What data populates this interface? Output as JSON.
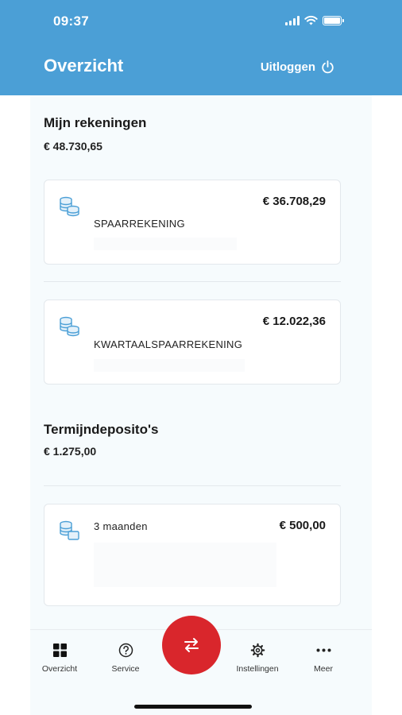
{
  "status_bar": {
    "time": "09:37",
    "icons": [
      "signal-icon",
      "wifi-icon",
      "battery-icon"
    ]
  },
  "header": {
    "title": "Overzicht",
    "logout_label": "Uitloggen",
    "logout_icon": "power-icon",
    "background": "#4b9fd6"
  },
  "accounts": {
    "title": "Mijn rekeningen",
    "total": "€ 48.730,65",
    "items": [
      {
        "label": "SPAARREKENING",
        "amount": "€ 36.708,29",
        "icon": "coins-stack-icon"
      },
      {
        "label": "KWARTAALSPAARREKENING",
        "amount": "€ 12.022,36",
        "icon": "coins-stack-icon"
      }
    ]
  },
  "deposits": {
    "title": "Termijndeposito's",
    "total": "€ 1.275,00",
    "items": [
      {
        "label": "3 maanden",
        "amount": "€ 500,00",
        "icon": "coins-stack-icon"
      }
    ]
  },
  "tabbar": {
    "items": [
      {
        "label": "Overzicht",
        "icon": "grid-icon"
      },
      {
        "label": "Service",
        "icon": "help-circle-icon"
      },
      {
        "label": "Instellingen",
        "icon": "gear-icon"
      },
      {
        "label": "Meer",
        "icon": "more-dots-icon"
      }
    ],
    "fab_icon": "transfer-arrows-icon",
    "fab_color": "#d9262c"
  }
}
